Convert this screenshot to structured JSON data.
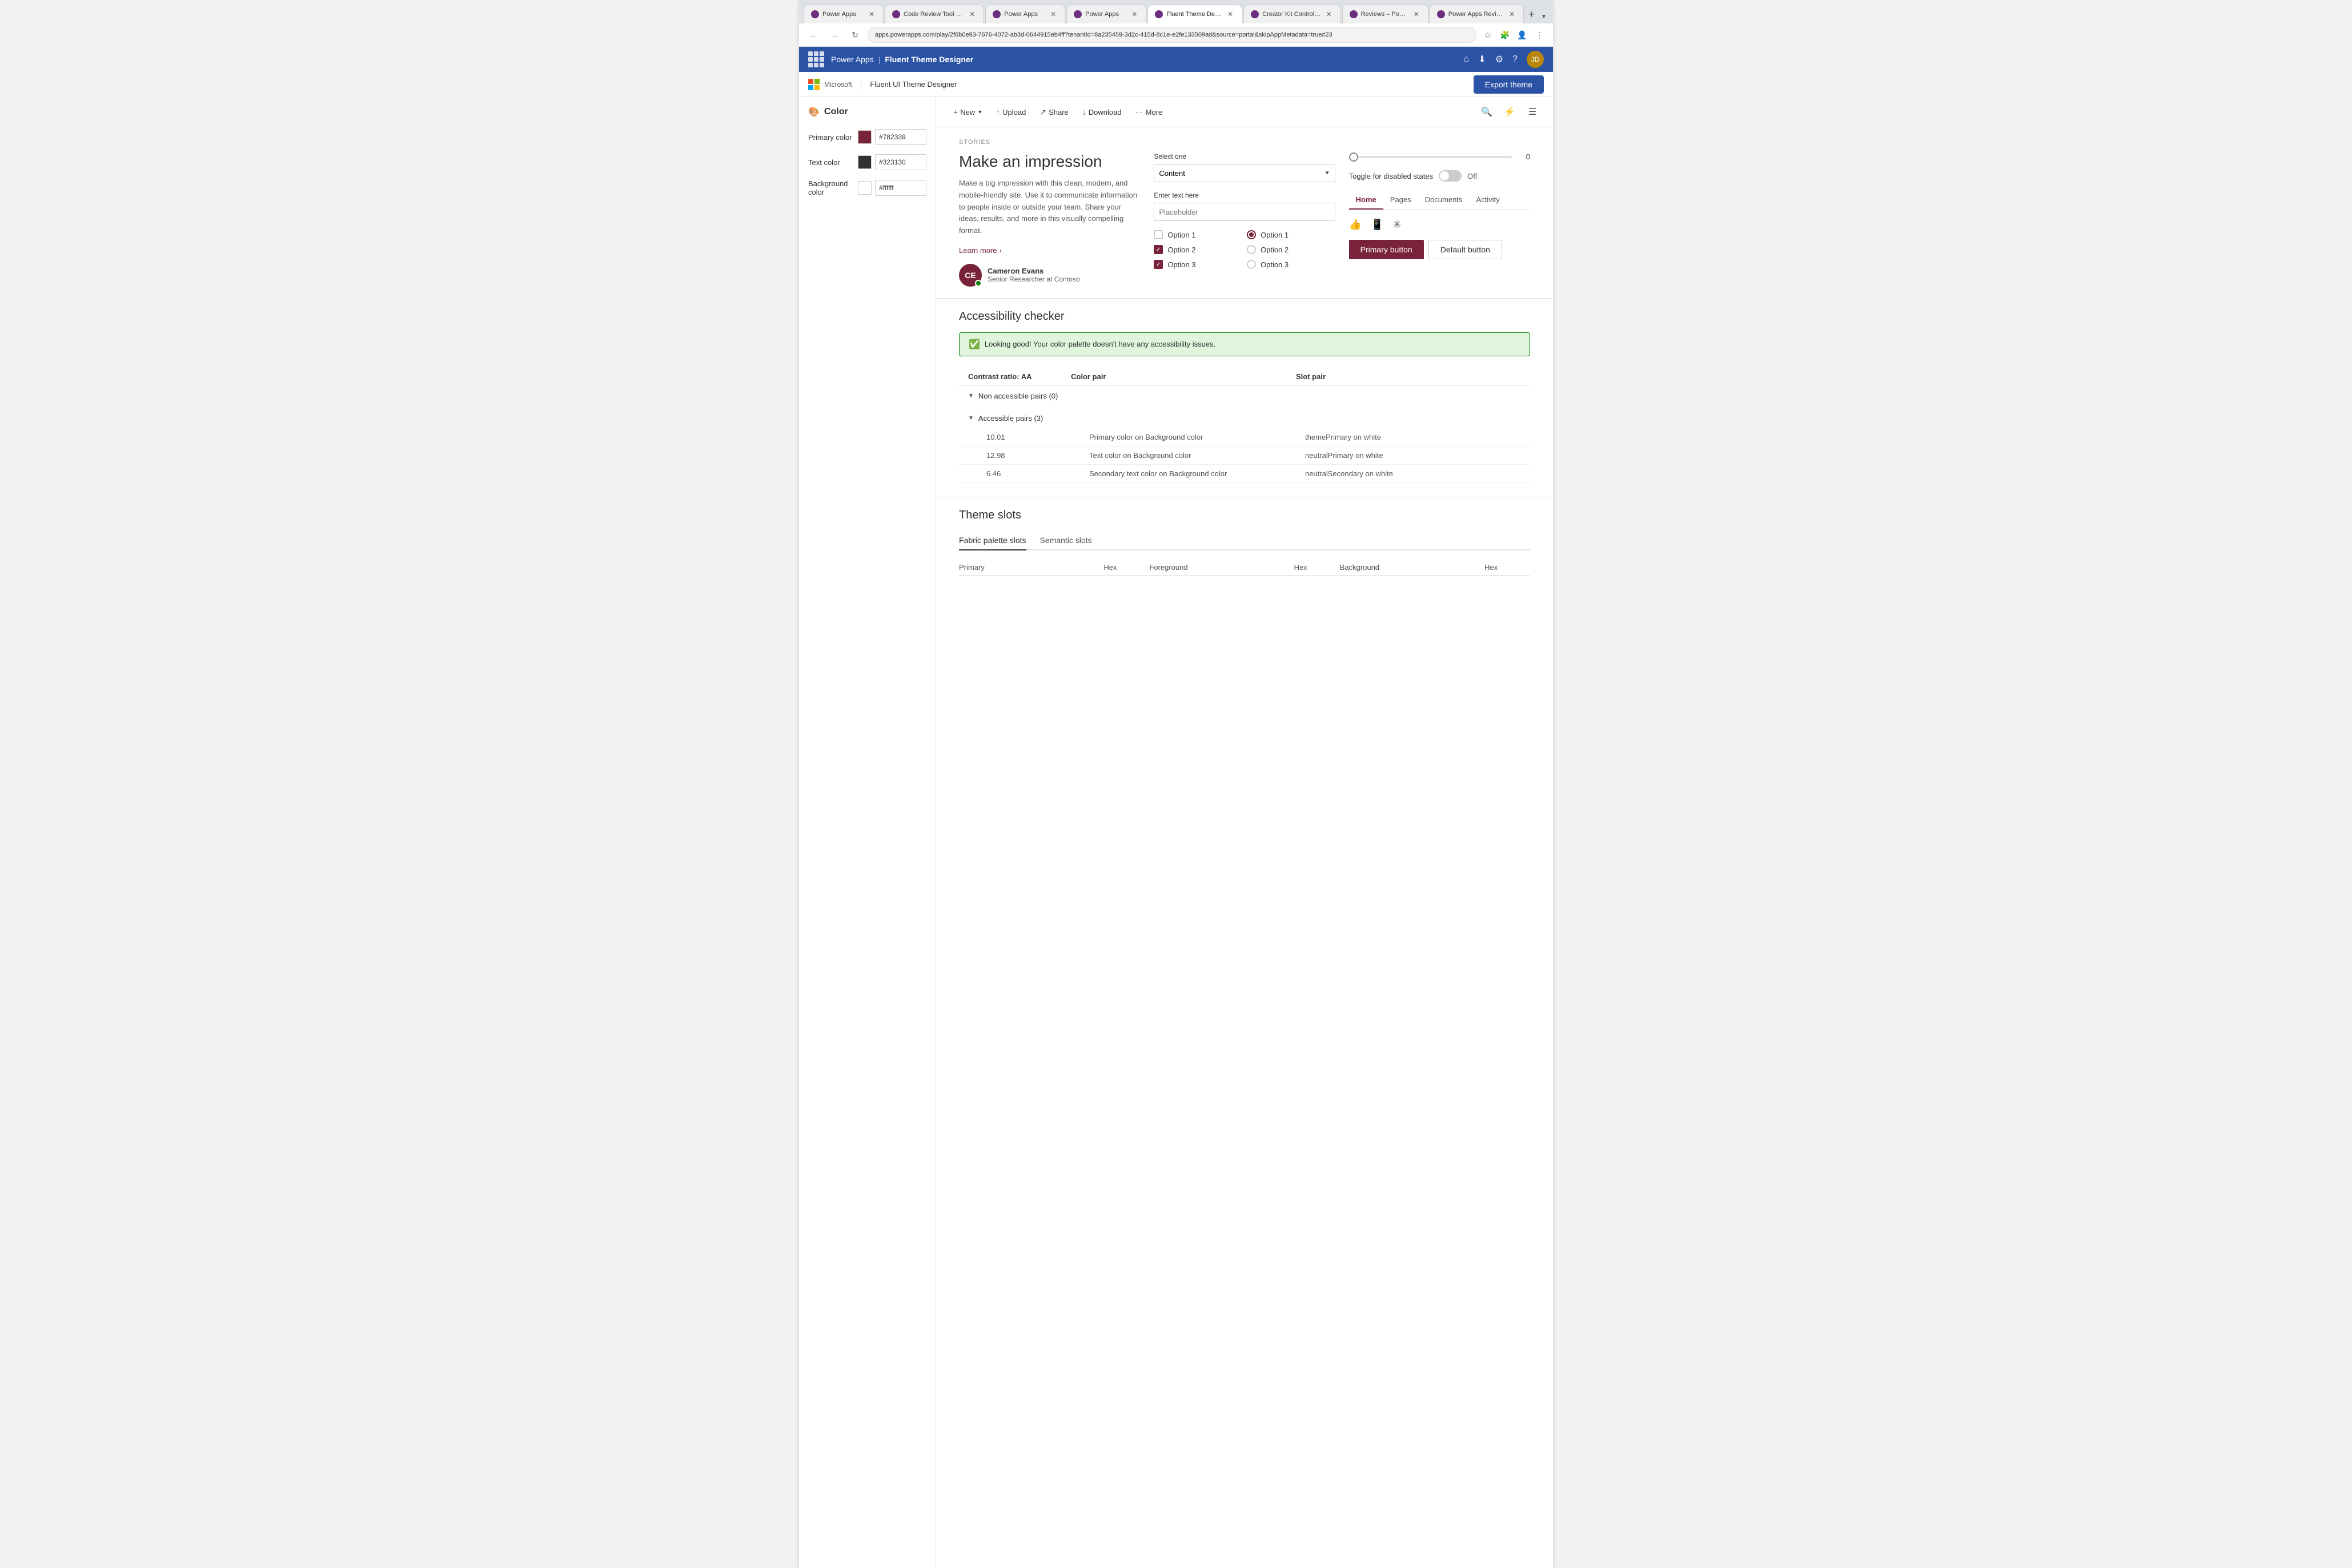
{
  "browser": {
    "tabs": [
      {
        "id": 1,
        "title": "Power Apps",
        "active": false,
        "color": "#6b2e7e"
      },
      {
        "id": 2,
        "title": "Code Review Tool Experim...",
        "active": false,
        "color": "#6b2e7e"
      },
      {
        "id": 3,
        "title": "Power Apps",
        "active": false,
        "color": "#6b2e7e"
      },
      {
        "id": 4,
        "title": "Power Apps",
        "active": false,
        "color": "#6b2e7e"
      },
      {
        "id": 5,
        "title": "Fluent Theme Designer -...",
        "active": true,
        "color": "#6b2e7e"
      },
      {
        "id": 6,
        "title": "Creator Kit Control Refere...",
        "active": false,
        "color": "#6b2e7e"
      },
      {
        "id": 7,
        "title": "Reviews – Power Apps",
        "active": false,
        "color": "#6b2e7e"
      },
      {
        "id": 8,
        "title": "Power Apps Review Tool...",
        "active": false,
        "color": "#6b2e7e"
      }
    ],
    "url": "apps.powerapps.com/play/2f6b0e93-7676-4072-ab3d-0644915eb4ff?tenantId=8a235459-3d2c-415d-8c1e-e2fe133509ad&source=portal&skipAppMetadata=true#23"
  },
  "appHeader": {
    "appName": "Power Apps",
    "separator": "|",
    "section": "Fluent Theme Designer"
  },
  "subHeader": {
    "msLogo": "Microsoft",
    "title": "Fluent UI Theme Designer",
    "exportBtn": "Export theme"
  },
  "sidebar": {
    "sectionIcon": "🎨",
    "sectionTitle": "Color",
    "colors": [
      {
        "label": "Primary color",
        "hex": "#782339",
        "swatchColor": "#782339"
      },
      {
        "label": "Text color",
        "hex": "#323130",
        "swatchColor": "#323130"
      },
      {
        "label": "Background color",
        "hex": "#ffffff",
        "swatchColor": "#ffffff"
      }
    ]
  },
  "toolbar": {
    "new_label": "New",
    "upload_label": "Upload",
    "share_label": "Share",
    "download_label": "Download",
    "more_label": "More",
    "search_icon": "🔍",
    "filter_icon": "⚡",
    "list_icon": "☰"
  },
  "preview": {
    "storiesLabel": "STORIES",
    "headline": "Make an impression",
    "body": "Make a big impression with this clean, modern, and mobile-friendly site. Use it to communicate information to people inside or outside your team. Share your ideas, results, and more in this visually compelling format.",
    "learnMore": "Learn more",
    "person": {
      "initials": "CE",
      "name": "Cameron Evans",
      "title": "Senior Researcher at Contoso"
    },
    "centerPanel": {
      "selectLabel": "Select one",
      "selectValue": "Content",
      "textLabel": "Enter text here",
      "textPlaceholder": "Placeholder",
      "checkboxOptions": [
        {
          "label": "Option 1",
          "checked": false
        },
        {
          "label": "Option 2",
          "checked": true
        },
        {
          "label": "Option 3",
          "checked": true
        }
      ],
      "radioOptions": [
        {
          "label": "Option 1",
          "selected": true
        },
        {
          "label": "Option 2",
          "selected": false
        },
        {
          "label": "Option 3",
          "selected": false
        }
      ]
    },
    "rightPanel": {
      "sliderValue": "0",
      "toggleLabel": "Toggle for disabled states",
      "toggleState": "Off",
      "tabs": [
        {
          "label": "Home",
          "active": true
        },
        {
          "label": "Pages",
          "active": false
        },
        {
          "label": "Documents",
          "active": false
        },
        {
          "label": "Activity",
          "active": false
        }
      ],
      "primaryBtn": "Primary button",
      "defaultBtn": "Default button"
    }
  },
  "accessibility": {
    "title": "Accessibility checker",
    "successMessage": "Looking good! Your color palette doesn't have any accessibility issues.",
    "tableHeaders": [
      "Contrast ratio: AA",
      "Color pair",
      "Slot pair"
    ],
    "groups": [
      {
        "label": "Non accessible pairs (0)",
        "rows": []
      },
      {
        "label": "Accessible pairs (3)",
        "rows": [
          {
            "ratio": "10.01",
            "colorPair": "Primary color on Background color",
            "slotPair": "themePrimary on white"
          },
          {
            "ratio": "12.98",
            "colorPair": "Text color on Background color",
            "slotPair": "neutralPrimary on white"
          },
          {
            "ratio": "6.46",
            "colorPair": "Secondary text color on Background color",
            "slotPair": "neutralSecondary on white"
          }
        ]
      }
    ]
  },
  "themeSlots": {
    "title": "Theme slots",
    "tabs": [
      {
        "label": "Fabric palette slots",
        "active": true
      },
      {
        "label": "Semantic slots",
        "active": false
      }
    ],
    "tableHeaders": [
      "Primary",
      "Hex",
      "Foreground",
      "Hex",
      "Background",
      "Hex"
    ]
  }
}
